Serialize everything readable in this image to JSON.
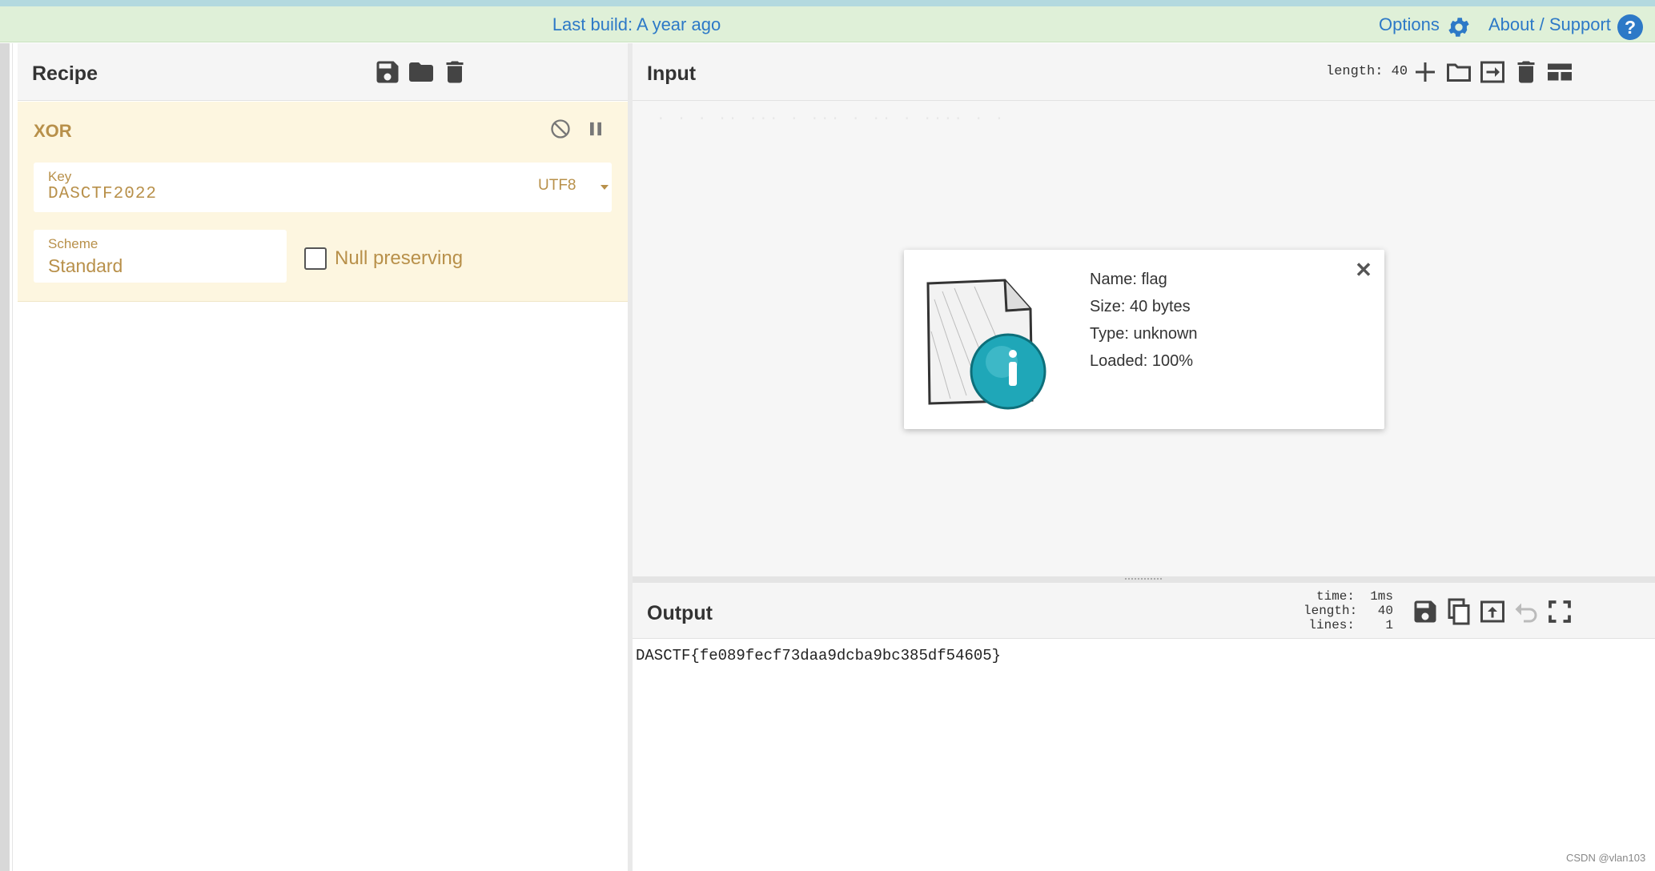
{
  "banner": {
    "build": "Last build: A year ago",
    "options": "Options",
    "about": "About / Support",
    "help_glyph": "?"
  },
  "recipe": {
    "title": "Recipe",
    "icons": [
      "save-icon",
      "folder-icon",
      "trash-icon"
    ],
    "operation": {
      "name": "XOR",
      "key_label": "Key",
      "key_value": "DASCTF2022",
      "key_encoding": "UTF8",
      "scheme_label": "Scheme",
      "scheme_value": "Standard",
      "null_preserving_label": "Null preserving",
      "null_preserving_checked": false
    }
  },
  "input": {
    "title": "Input",
    "length": "length: 40",
    "icons": [
      "plus-icon",
      "folder-icon",
      "import-icon",
      "trash-icon",
      "layout-icon"
    ],
    "ghost_text": "· · ·  ·· ··· · ··· ·  ·· ·  ···· · ·",
    "file": {
      "name": "Name: flag",
      "size": "Size: 40 bytes",
      "type": "Type: unknown",
      "loaded": "Loaded: 100%",
      "close": "✕"
    }
  },
  "output": {
    "title": "Output",
    "stats": {
      "time_label": "time:",
      "time_value": "1ms",
      "length_label": "length:",
      "length_value": "40",
      "lines_label": "lines:",
      "lines_value": "1"
    },
    "icons": [
      "save-icon",
      "copy-icon",
      "replace-input-icon",
      "undo-icon",
      "maximize-icon"
    ],
    "text": "DASCTF{fe089fecf73daa9dcba9bc385df54605}",
    "watermark": "CSDN @vlan103"
  },
  "colors": {
    "accent": "#2d79c7",
    "banner_bg": "#dff0d8",
    "operation_bg": "#fdf6e0",
    "operation_text": "#b8904a"
  }
}
